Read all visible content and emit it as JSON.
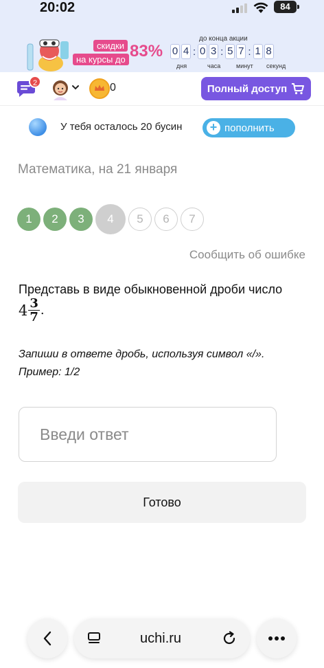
{
  "status_bar": {
    "time": "20:02",
    "battery": "84"
  },
  "promo": {
    "line1": "скидки",
    "line2": "на курсы до",
    "percent": "83%",
    "countdown_title": "до конца акции",
    "days": [
      "0",
      "4"
    ],
    "hours": [
      "0",
      "3"
    ],
    "minutes": [
      "5",
      "7"
    ],
    "seconds": [
      "1",
      "8"
    ],
    "labels": [
      "дня",
      "часа",
      "минут",
      "секунд"
    ]
  },
  "header": {
    "chat_badge": "2",
    "coins": "0",
    "full_access_label": "Полный доступ"
  },
  "beads": {
    "text": "У тебя осталось 20 бусин",
    "topup_label": "пополнить"
  },
  "subject_title": "Математика, на 21 января",
  "steps": [
    {
      "label": "1",
      "state": "done"
    },
    {
      "label": "2",
      "state": "done"
    },
    {
      "label": "3",
      "state": "done"
    },
    {
      "label": "4",
      "state": "current"
    },
    {
      "label": "5",
      "state": "todo"
    },
    {
      "label": "6",
      "state": "todo"
    },
    {
      "label": "7",
      "state": "todo"
    }
  ],
  "report_error": "Сообщить об ошибке",
  "task": {
    "text": "Представь в виде обыкновенной дроби число",
    "whole": "4",
    "numerator": "3",
    "denominator": "7",
    "period": ".",
    "hint_line1": "Запиши в ответе дробь, используя символ «/».",
    "hint_line2": "Пример: 1/2"
  },
  "answer": {
    "placeholder": "Введи ответ",
    "value": ""
  },
  "done_label": "Готово",
  "browser": {
    "url": "uchi.ru"
  },
  "colors": {
    "accent_purple": "#7857e1",
    "topup_blue": "#4ab1e6",
    "done_green": "#7db07a",
    "promo_pink": "#e64b8c"
  },
  "icons": [
    "chat-icon",
    "avatar",
    "chevron-down-icon",
    "crown-coin-icon",
    "cart-icon",
    "bead-icon",
    "plus-icon",
    "back-icon",
    "tabs-icon",
    "reload-icon",
    "more-icon"
  ]
}
